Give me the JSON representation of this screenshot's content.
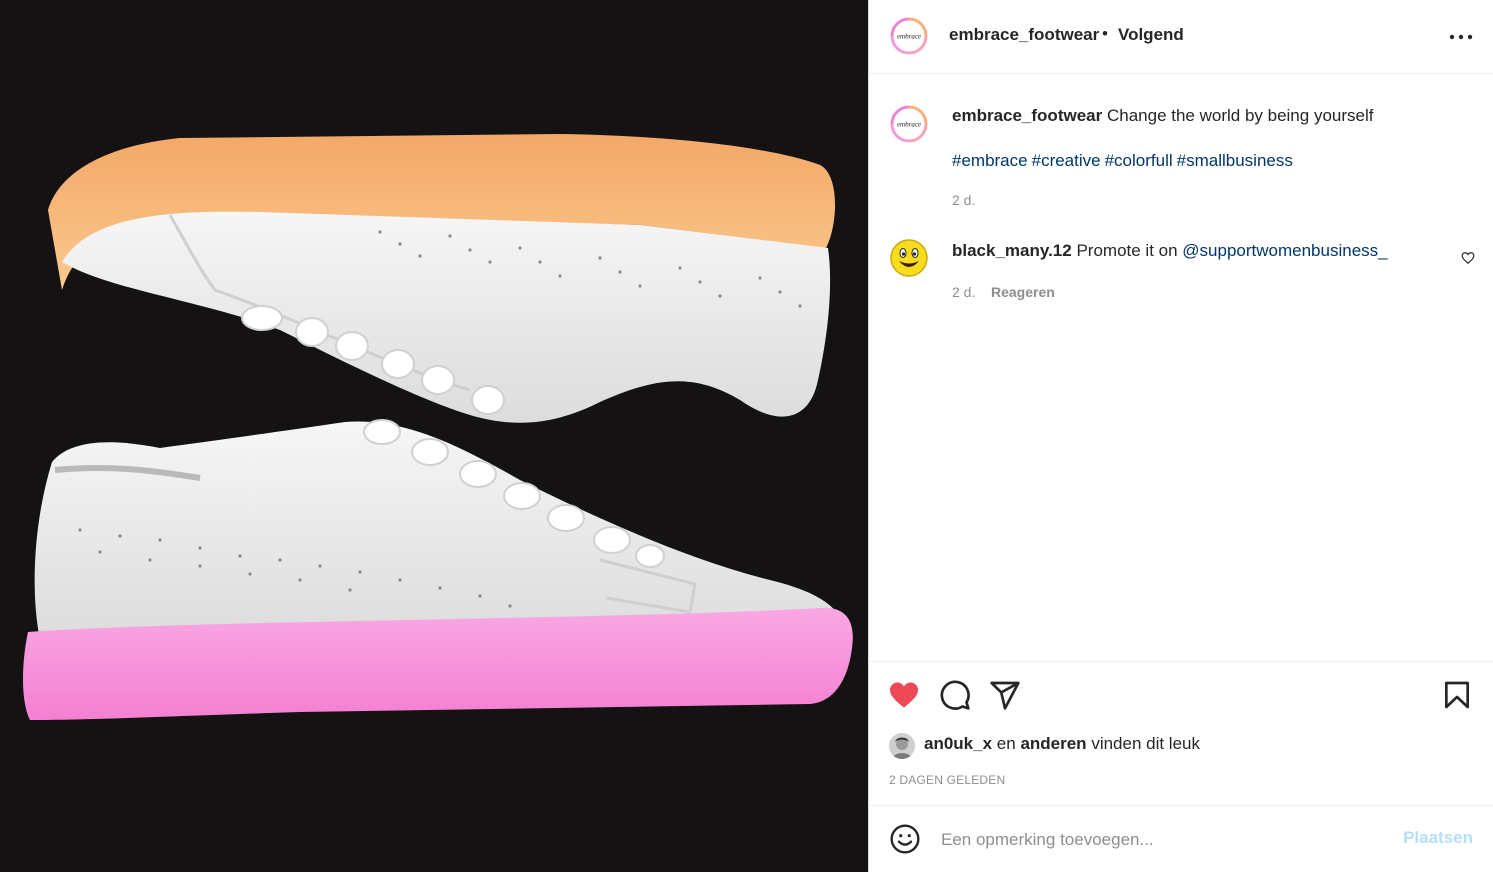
{
  "post": {
    "username": "embrace_footwear",
    "separator": "•",
    "follow_state": "Volgend",
    "avatar_text": "embrace",
    "caption": {
      "username": "embrace_footwear",
      "text": "Change the world by being yourself",
      "hashtags": [
        "#embrace",
        "#creative",
        "#colorfull",
        "#smallbusiness"
      ],
      "time": "2 d."
    },
    "comments": [
      {
        "username": "black_many.12",
        "text": "Promote it on",
        "mention": "@supportwomenbusiness_",
        "time": "2 d.",
        "reply_label": "Reageren"
      }
    ],
    "likes": {
      "user": "an0uk_x",
      "connector": "en",
      "others": "anderen",
      "suffix": "vinden dit leuk"
    },
    "date": "2 DAGEN GELEDEN",
    "add_comment": {
      "placeholder": "Een opmerking toevoegen...",
      "submit_label": "Plaatsen"
    }
  },
  "colors": {
    "media_background": "#141213",
    "sole_top": "#f9bd7c",
    "sole_bottom": "#f58ad6",
    "like_active": "#ed4956",
    "link": "#00376b",
    "submit_disabled": "#b2dffc"
  },
  "icons": [
    "more-icon",
    "heart-icon",
    "comment-icon",
    "share-icon",
    "bookmark-icon",
    "emoji-icon",
    "like-comment-icon"
  ]
}
